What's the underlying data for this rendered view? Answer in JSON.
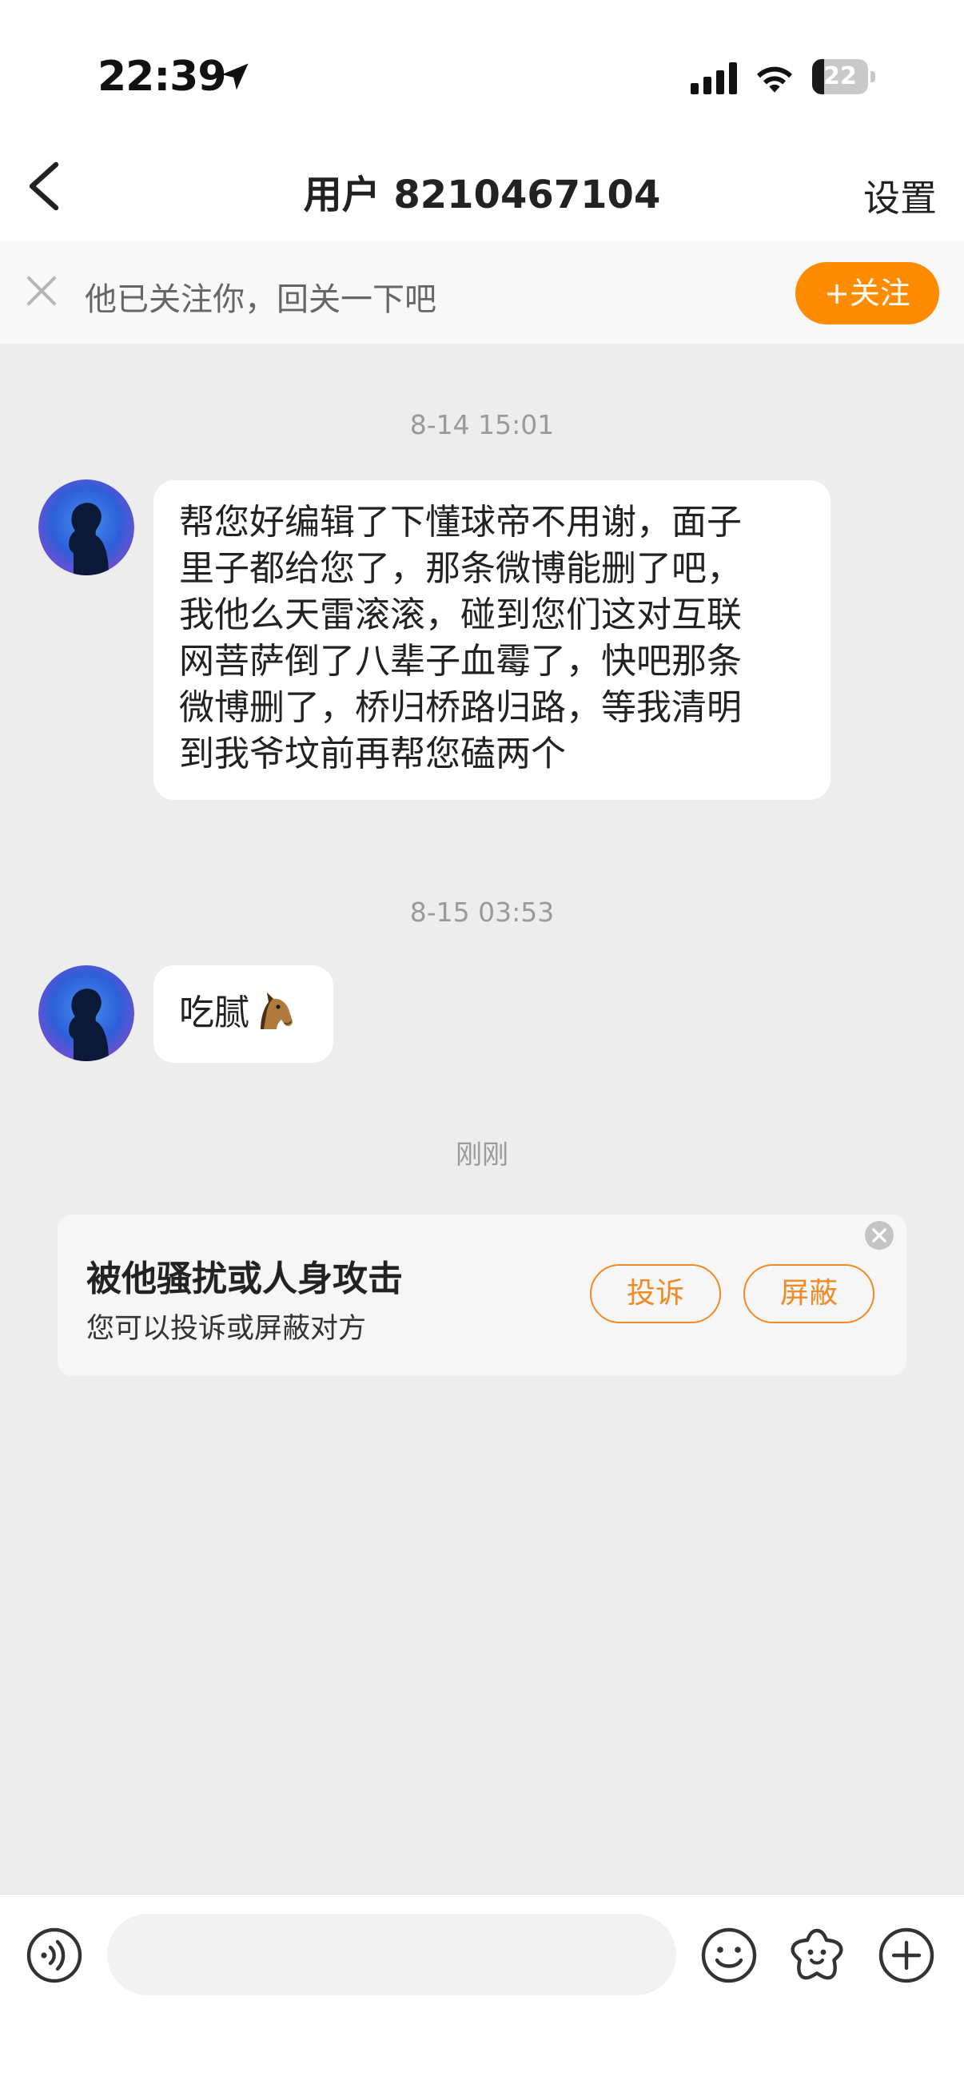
{
  "status_bar": {
    "time": "22:39",
    "battery": "22",
    "battery_fraction": 0.22
  },
  "header": {
    "title": "用户 8210467104",
    "settings_label": "设置"
  },
  "follow_banner": {
    "text": "他已关注你，回关一下吧",
    "button_label": "+关注"
  },
  "messages": [
    {
      "timestamp": "8-14 15:01",
      "lines": [
        "帮您好编辑了下懂球帝不用谢，面子",
        "里子都给您了，那条微博能删了吧，",
        "我他么天雷滚滚，碰到您们这对互联",
        "网菩萨倒了八辈子血霉了，快吧那条",
        "微博删了，桥归桥路归路，等我清明",
        "到我爷坟前再帮您磕两个"
      ]
    },
    {
      "timestamp": "8-15 03:53",
      "text": "吃腻",
      "emoji": "horse-face"
    }
  ],
  "system_time": "刚刚",
  "report_card": {
    "title": "被他骚扰或人身攻击",
    "subtitle": "您可以投诉或屏蔽对方",
    "complain_label": "投诉",
    "block_label": "屏蔽"
  },
  "input_bar": {
    "placeholder": ""
  },
  "colors": {
    "accent": "#ff8c00",
    "outline_accent": "#f08a24",
    "background": "#ededed"
  }
}
